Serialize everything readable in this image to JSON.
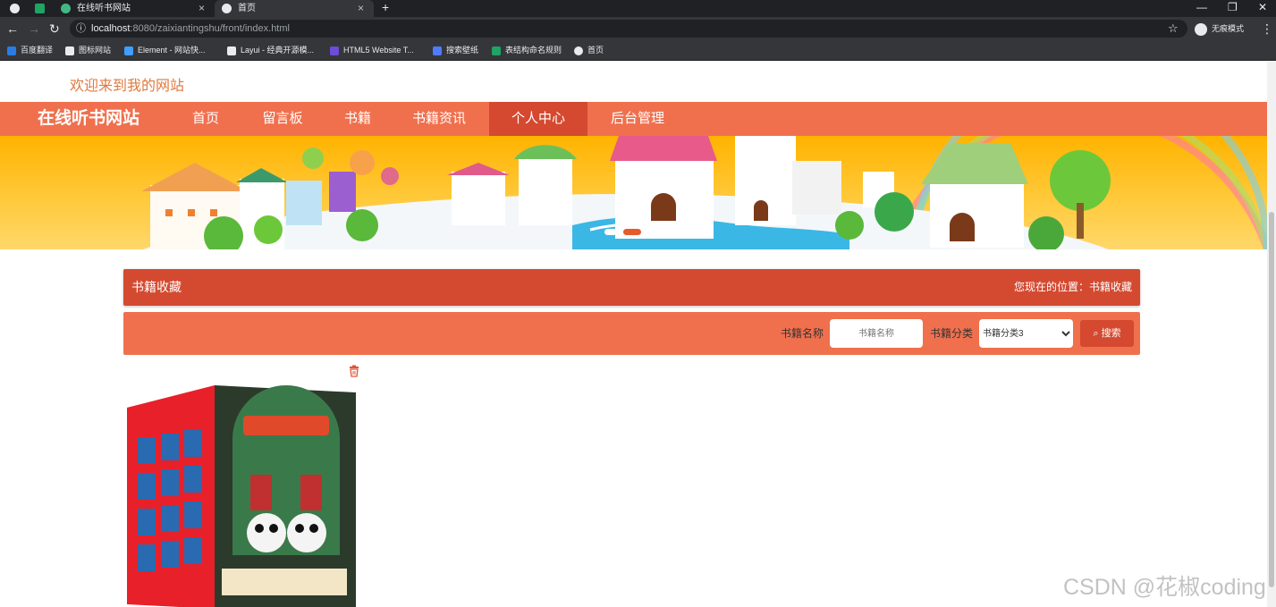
{
  "browser": {
    "tabs": [
      {
        "label": "在线听书网站",
        "active": false
      },
      {
        "label": "首页",
        "active": true
      }
    ],
    "new_tab": "+",
    "window_controls": [
      "—",
      "❐",
      "✕"
    ],
    "url_host": "localhost",
    "url_rest": ":8080/zaixiantingshu/front/index.html",
    "incognito_label": "无痕模式",
    "bookmarks": [
      {
        "label": "百度翻译",
        "color": "#2b7be5"
      },
      {
        "label": "图标网站",
        "color": "#e8eaed"
      },
      {
        "label": "Element - 网站快...",
        "color": "#409eff"
      },
      {
        "label": "Layui - 经典开源模...",
        "color": "#e8eaed"
      },
      {
        "label": "HTML5 Website T...",
        "color": "#6c4cd8"
      },
      {
        "label": "搜索壁纸",
        "color": "#4f7cff"
      },
      {
        "label": "表结构命名规则",
        "color": "#1fa463"
      },
      {
        "label": "首页",
        "color": "#e8eaed"
      }
    ]
  },
  "site": {
    "welcome": "欢迎来到我的网站",
    "brand": "在线听书网站",
    "nav": [
      {
        "label": "首页",
        "active": false
      },
      {
        "label": "留言板",
        "active": false
      },
      {
        "label": "书籍",
        "active": false
      },
      {
        "label": "书籍资讯",
        "active": false
      },
      {
        "label": "个人中心",
        "active": true
      },
      {
        "label": "后台管理",
        "active": false
      }
    ],
    "colors": {
      "nav": "#f0704e",
      "nav_active": "#d4492f",
      "welcome": "#e0793e"
    }
  },
  "breadcrumb": {
    "title": "书籍收藏",
    "location": "您现在的位置：书籍收藏"
  },
  "search": {
    "name_label": "书籍名称",
    "name_placeholder": "书籍名称",
    "category_label": "书籍分类",
    "category_selected": "书籍分类3",
    "button_label": "搜索"
  },
  "watermark": "CSDN @花椒coding"
}
